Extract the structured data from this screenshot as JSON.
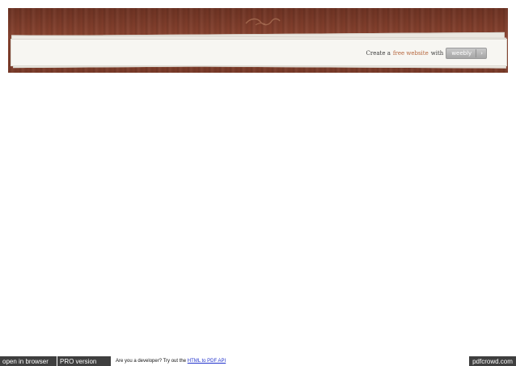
{
  "header": {
    "ornament_icon": "scroll-ornament-icon"
  },
  "credit": {
    "prefix": "Create a",
    "link_text": "free website",
    "suffix": "with",
    "badge_label": "weebly",
    "badge_icon": "dropdown-arrow-icon",
    "badge_glyph": "›"
  },
  "footer": {
    "open_in_browser": "open in browser",
    "pro_version": "PRO version",
    "developer_text": "Are you a developer? Try out the",
    "api_link": "HTML to PDF API",
    "brand": "pdfcrowd.com"
  },
  "colors": {
    "wood": "#7a3a28",
    "accent_link": "#b5643a",
    "footer_bar": "#3f3f3f"
  }
}
